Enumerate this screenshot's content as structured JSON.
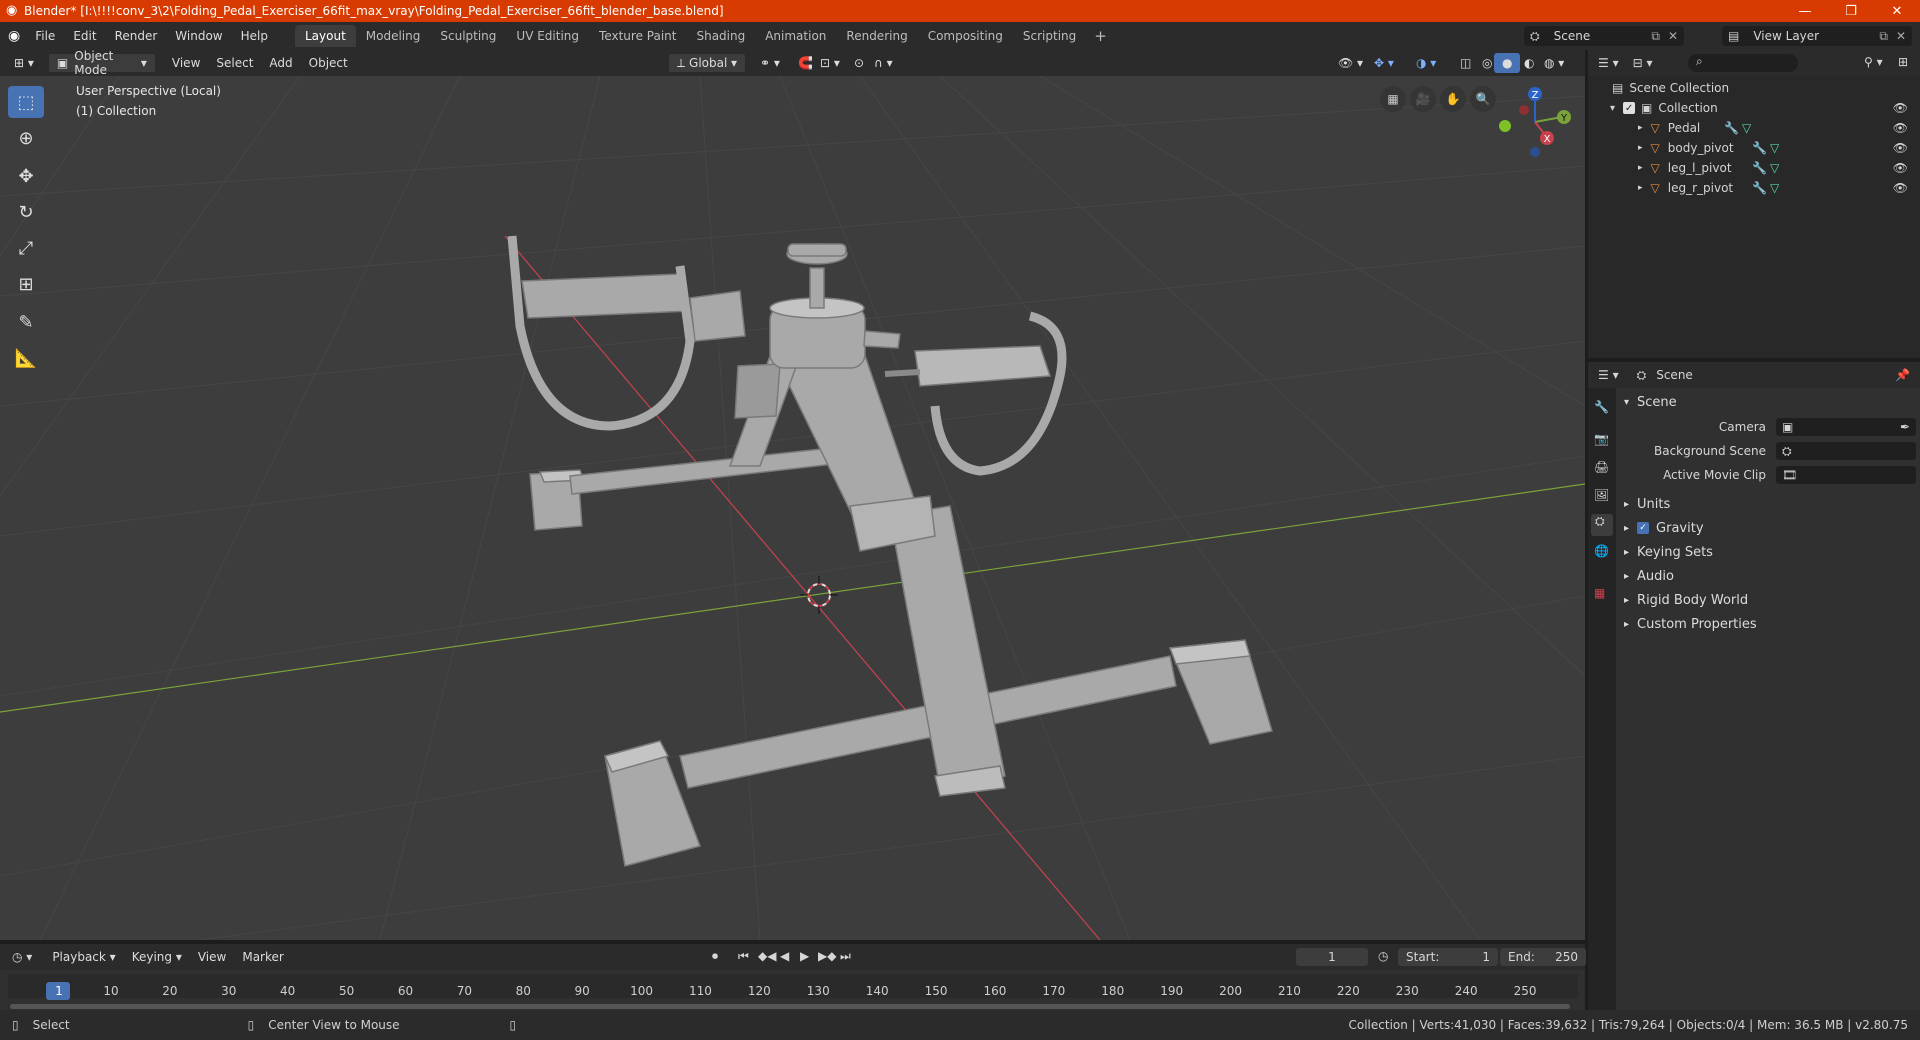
{
  "window": {
    "title": "Blender* [I:\\!!!!conv_3\\2\\Folding_Pedal_Exerciser_66fit_max_vray\\Folding_Pedal_Exerciser_66fit_blender_base.blend]"
  },
  "menu": [
    "File",
    "Edit",
    "Render",
    "Window",
    "Help"
  ],
  "workspaces": [
    "Layout",
    "Modeling",
    "Sculpting",
    "UV Editing",
    "Texture Paint",
    "Shading",
    "Animation",
    "Rendering",
    "Compositing",
    "Scripting"
  ],
  "scene_field": "Scene",
  "view_layer_field": "View Layer",
  "viewport_header": {
    "mode": "Object Mode",
    "menus": [
      "View",
      "Select",
      "Add",
      "Object"
    ],
    "transform_orientation": "Global"
  },
  "viewport": {
    "perspective": "User Perspective (Local)",
    "collection": "(1) Collection",
    "gizmo": {
      "z": "Z",
      "y": "Y",
      "x": "X"
    }
  },
  "outliner": {
    "root": "Scene Collection",
    "collection": "Collection",
    "items": [
      "Pedal",
      "body_pivot",
      "leg_l_pivot",
      "leg_r_pivot"
    ]
  },
  "properties": {
    "header": "Scene",
    "section": "Scene",
    "fields": [
      {
        "label": "Camera"
      },
      {
        "label": "Background Scene"
      },
      {
        "label": "Active Movie Clip"
      }
    ],
    "subsections": [
      "Units",
      "Gravity",
      "Keying Sets",
      "Audio",
      "Rigid Body World",
      "Custom Properties"
    ],
    "gravity_checked": true
  },
  "timeline": {
    "menus": [
      "Playback",
      "Keying",
      "View",
      "Marker"
    ],
    "current_frame": "1",
    "start_label": "Start:",
    "start": "1",
    "end_label": "End:",
    "end": "250",
    "ticks": [
      "1",
      "10",
      "20",
      "30",
      "40",
      "50",
      "60",
      "70",
      "80",
      "90",
      "100",
      "110",
      "120",
      "130",
      "140",
      "150",
      "160",
      "170",
      "180",
      "190",
      "200",
      "210",
      "220",
      "230",
      "240",
      "250"
    ]
  },
  "statusbar": {
    "select": "Select",
    "center_view": "Center View to Mouse",
    "stats": "Collection | Verts:41,030 | Faces:39,632 | Tris:79,264 | Objects:0/4 | Mem: 36.5 MB | v2.80.75"
  },
  "colors": {
    "titlebar": "#d83b01",
    "accent": "#4772b3",
    "viewport_bg": "#3d3d3d",
    "x_axis": "#c8424e",
    "y_axis": "#7aa23a",
    "object_orange": "#e8883a"
  }
}
